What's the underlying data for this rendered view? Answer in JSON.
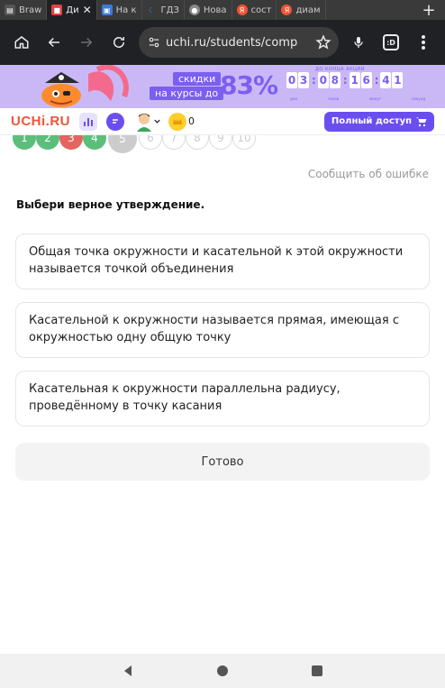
{
  "browser": {
    "tabs": [
      {
        "label": "Braw",
        "active": false
      },
      {
        "label": "Ди",
        "active": true
      },
      {
        "label": "На к",
        "active": false
      },
      {
        "label": "ГДЗ",
        "active": false
      },
      {
        "label": "Нова",
        "active": false
      },
      {
        "label": "сост",
        "active": false
      },
      {
        "label": "диам",
        "active": false
      }
    ],
    "new_tab": "+",
    "url": "uchi.ru/students/comp",
    "tab_count": ":D"
  },
  "promo": {
    "line1": "скидки",
    "line2": "на курсы до",
    "percent": "83%",
    "timer_caption": "ДО КОНЦА АКЦИИ",
    "timer_digits": [
      "0",
      "3",
      "0",
      "8",
      "1",
      "6",
      "4",
      "1"
    ],
    "timer_units": [
      "дни",
      "часов",
      "минут",
      "секунд"
    ]
  },
  "header": {
    "logo": "UCHi.RU",
    "coins": "0",
    "full_access": "Полный доступ"
  },
  "progress": {
    "items": [
      {
        "n": "1",
        "state": "green"
      },
      {
        "n": "2",
        "state": "green"
      },
      {
        "n": "3",
        "state": "red"
      },
      {
        "n": "4",
        "state": "green"
      },
      {
        "n": "5",
        "state": "current"
      },
      {
        "n": "6",
        "state": "empty"
      },
      {
        "n": "7",
        "state": "empty"
      },
      {
        "n": "8",
        "state": "empty"
      },
      {
        "n": "9",
        "state": "empty"
      },
      {
        "n": "10",
        "state": "empty"
      }
    ]
  },
  "task": {
    "report_error": "Сообщить об ошибке",
    "question": "Выбери верное утверждение.",
    "options": [
      "Общая точка окружности и касательной к этой окружности называется точкой объединения",
      "Касательной к окружности называется прямая, имеющая с окружностью одну общую точку",
      "Касательная к окружности параллельна радиусу, проведённому в точку касания"
    ],
    "done": "Готово"
  },
  "colors": {
    "brand_red": "#f0543a",
    "purple": "#6b4ef0",
    "green": "#5bbf7b",
    "red": "#e5645f"
  }
}
